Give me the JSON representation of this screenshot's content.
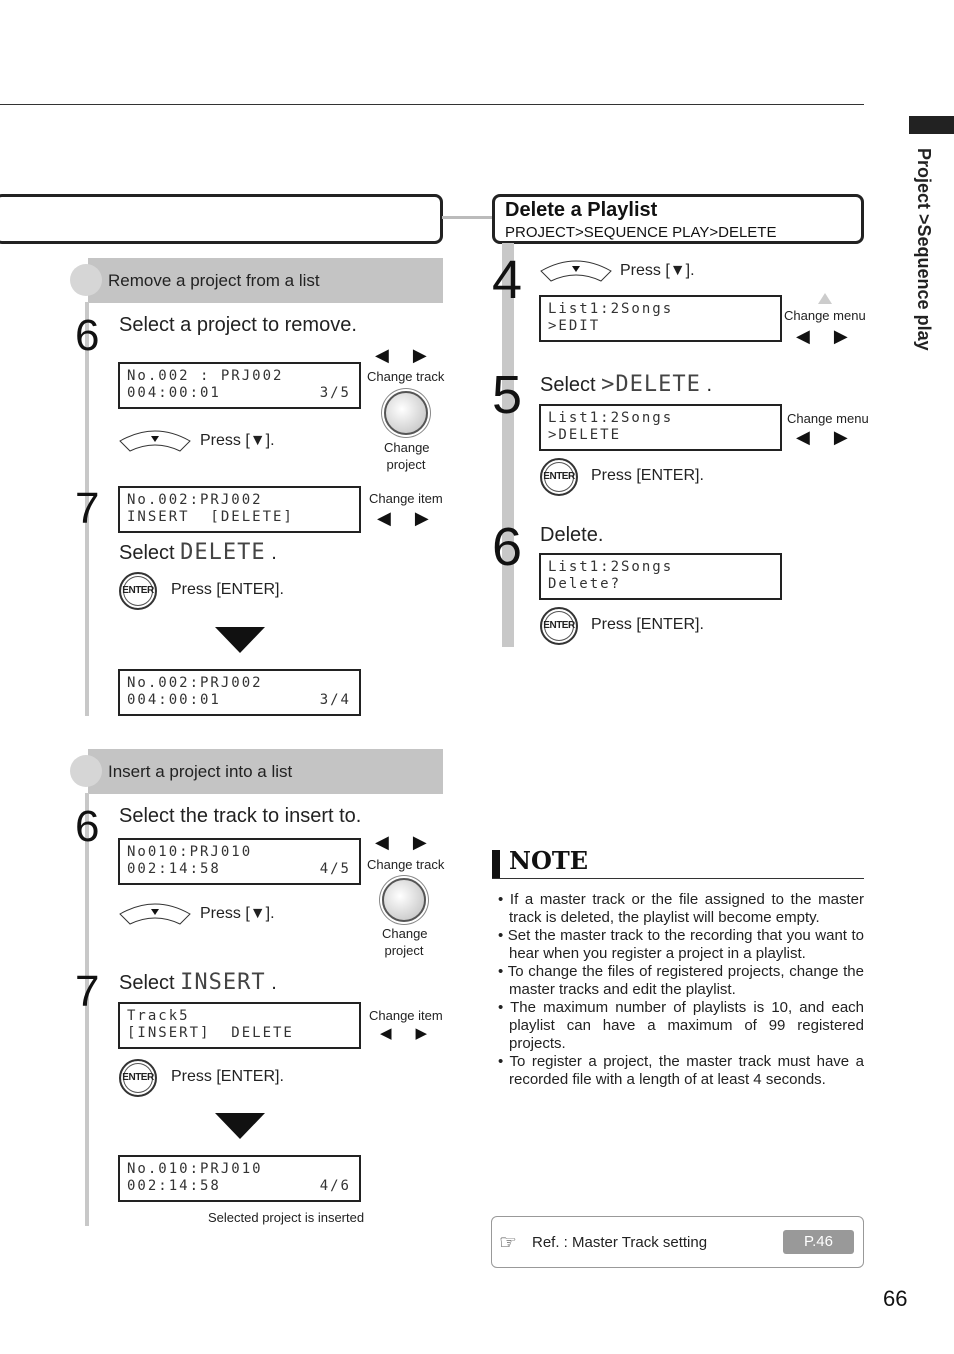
{
  "sidebar_tab": {
    "label": "Project >Sequence play"
  },
  "right_header": {
    "title": "Delete a Playlist",
    "path": "PROJECT>SEQUENCE PLAY>DELETE"
  },
  "remove": {
    "band": "Remove a project from a list",
    "step6": {
      "num": "6",
      "text": "Select a project to remove.",
      "lcd": [
        "No.002 : PRJ002",
        "004:00:01"
      ],
      "lcd_right": "3/5",
      "arrow_label": "Change track",
      "dial_label": [
        "Change",
        "project"
      ],
      "press": "Press [▼]."
    },
    "step7": {
      "num": "7",
      "lcd": [
        "No.002:PRJ002",
        "INSERT  [DELETE]"
      ],
      "arrow_label": "Change item",
      "select": "Select",
      "select_word": "DELETE",
      "select_end": ".",
      "press": "Press [ENTER]."
    },
    "result": {
      "lcd": [
        "No.002:PRJ002",
        "004:00:01"
      ],
      "lcd_right": "3/4"
    }
  },
  "insert": {
    "band": "Insert a project into a list",
    "step6": {
      "num": "6",
      "text": "Select the track to insert to.",
      "lcd": [
        "No010:PRJ010",
        "002:14:58"
      ],
      "lcd_right": "4/5",
      "arrow_label": "Change track",
      "dial_label": [
        "Change",
        "project"
      ],
      "press": "Press [▼]."
    },
    "step7": {
      "num": "7",
      "select": "Select",
      "select_word": "INSERT",
      "select_end": ".",
      "lcd": [
        "Track5",
        "[INSERT]  DELETE"
      ],
      "arrow_label": "Change item",
      "press": "Press [ENTER]."
    },
    "result": {
      "lcd": [
        "No.010:PRJ010",
        "002:14:58"
      ],
      "lcd_right": "4/6",
      "caption": "Selected project is inserted"
    }
  },
  "delete": {
    "step4": {
      "num": "4",
      "press": "Press [▼].",
      "lcd": [
        "List1:2Songs",
        ">EDIT"
      ],
      "arrow_label": "Change menu"
    },
    "step5": {
      "num": "5",
      "select": "Select",
      "select_word": ">DELETE",
      "select_end": ".",
      "lcd": [
        "List1:2Songs",
        ">DELETE"
      ],
      "arrow_label": "Change menu",
      "press": "Press [ENTER]."
    },
    "step6": {
      "num": "6",
      "text": "Delete.",
      "lcd": [
        "List1:2Songs",
        "Delete?"
      ],
      "press": "Press [ENTER]."
    }
  },
  "icons": {
    "enter": "ENTER",
    "arrows": "◀▶"
  },
  "note": {
    "title": "NOTE",
    "items": [
      "• If a master track or the file assigned to the master track is deleted, the playlist will become empty.",
      "• Set the master track to the recording that you want to hear when you register a project in a playlist.",
      "• To change the files of registered projects, change the master tracks and edit the playlist.",
      "• The maximum number of playlists is 10, and each playlist can have a maximum of 99 registered projects.",
      "• To register a project, the master track must have a recorded file with a length of at least 4 seconds."
    ]
  },
  "ref": {
    "icon": "☞",
    "text": "Ref. : Master Track setting",
    "page": "P.46"
  },
  "page_number": "66"
}
